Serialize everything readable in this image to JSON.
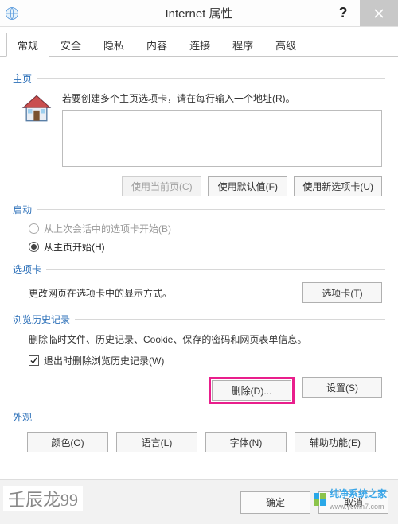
{
  "title": "Internet 属性",
  "tabs": [
    "常规",
    "安全",
    "隐私",
    "内容",
    "连接",
    "程序",
    "高级"
  ],
  "activeTab": 0,
  "sections": {
    "home": {
      "title": "主页",
      "instruction": "若要创建多个主页选项卡，请在每行输入一个地址(R)。",
      "textarea_value": "",
      "btn_current": "使用当前页(C)",
      "btn_default": "使用默认值(F)",
      "btn_newtab": "使用新选项卡(U)"
    },
    "startup": {
      "title": "启动",
      "opt_last": "从上次会话中的选项卡开始(B)",
      "opt_home": "从主页开始(H)"
    },
    "taboptions": {
      "title": "选项卡",
      "desc": "更改网页在选项卡中的显示方式。",
      "btn": "选项卡(T)"
    },
    "history": {
      "title": "浏览历史记录",
      "desc": "删除临时文件、历史记录、Cookie、保存的密码和网页表单信息。",
      "check": "退出时删除浏览历史记录(W)",
      "btn_delete": "删除(D)...",
      "btn_settings": "设置(S)"
    },
    "appearance": {
      "title": "外观",
      "btn_color": "颜色(O)",
      "btn_lang": "语言(L)",
      "btn_font": "字体(N)",
      "btn_access": "辅助功能(E)"
    }
  },
  "bottom": {
    "ok": "确定",
    "cancel": "取消"
  },
  "author": "壬辰龙99",
  "watermark": {
    "line1": "纯净系统之家",
    "line2": "www.ycwin7.com"
  }
}
